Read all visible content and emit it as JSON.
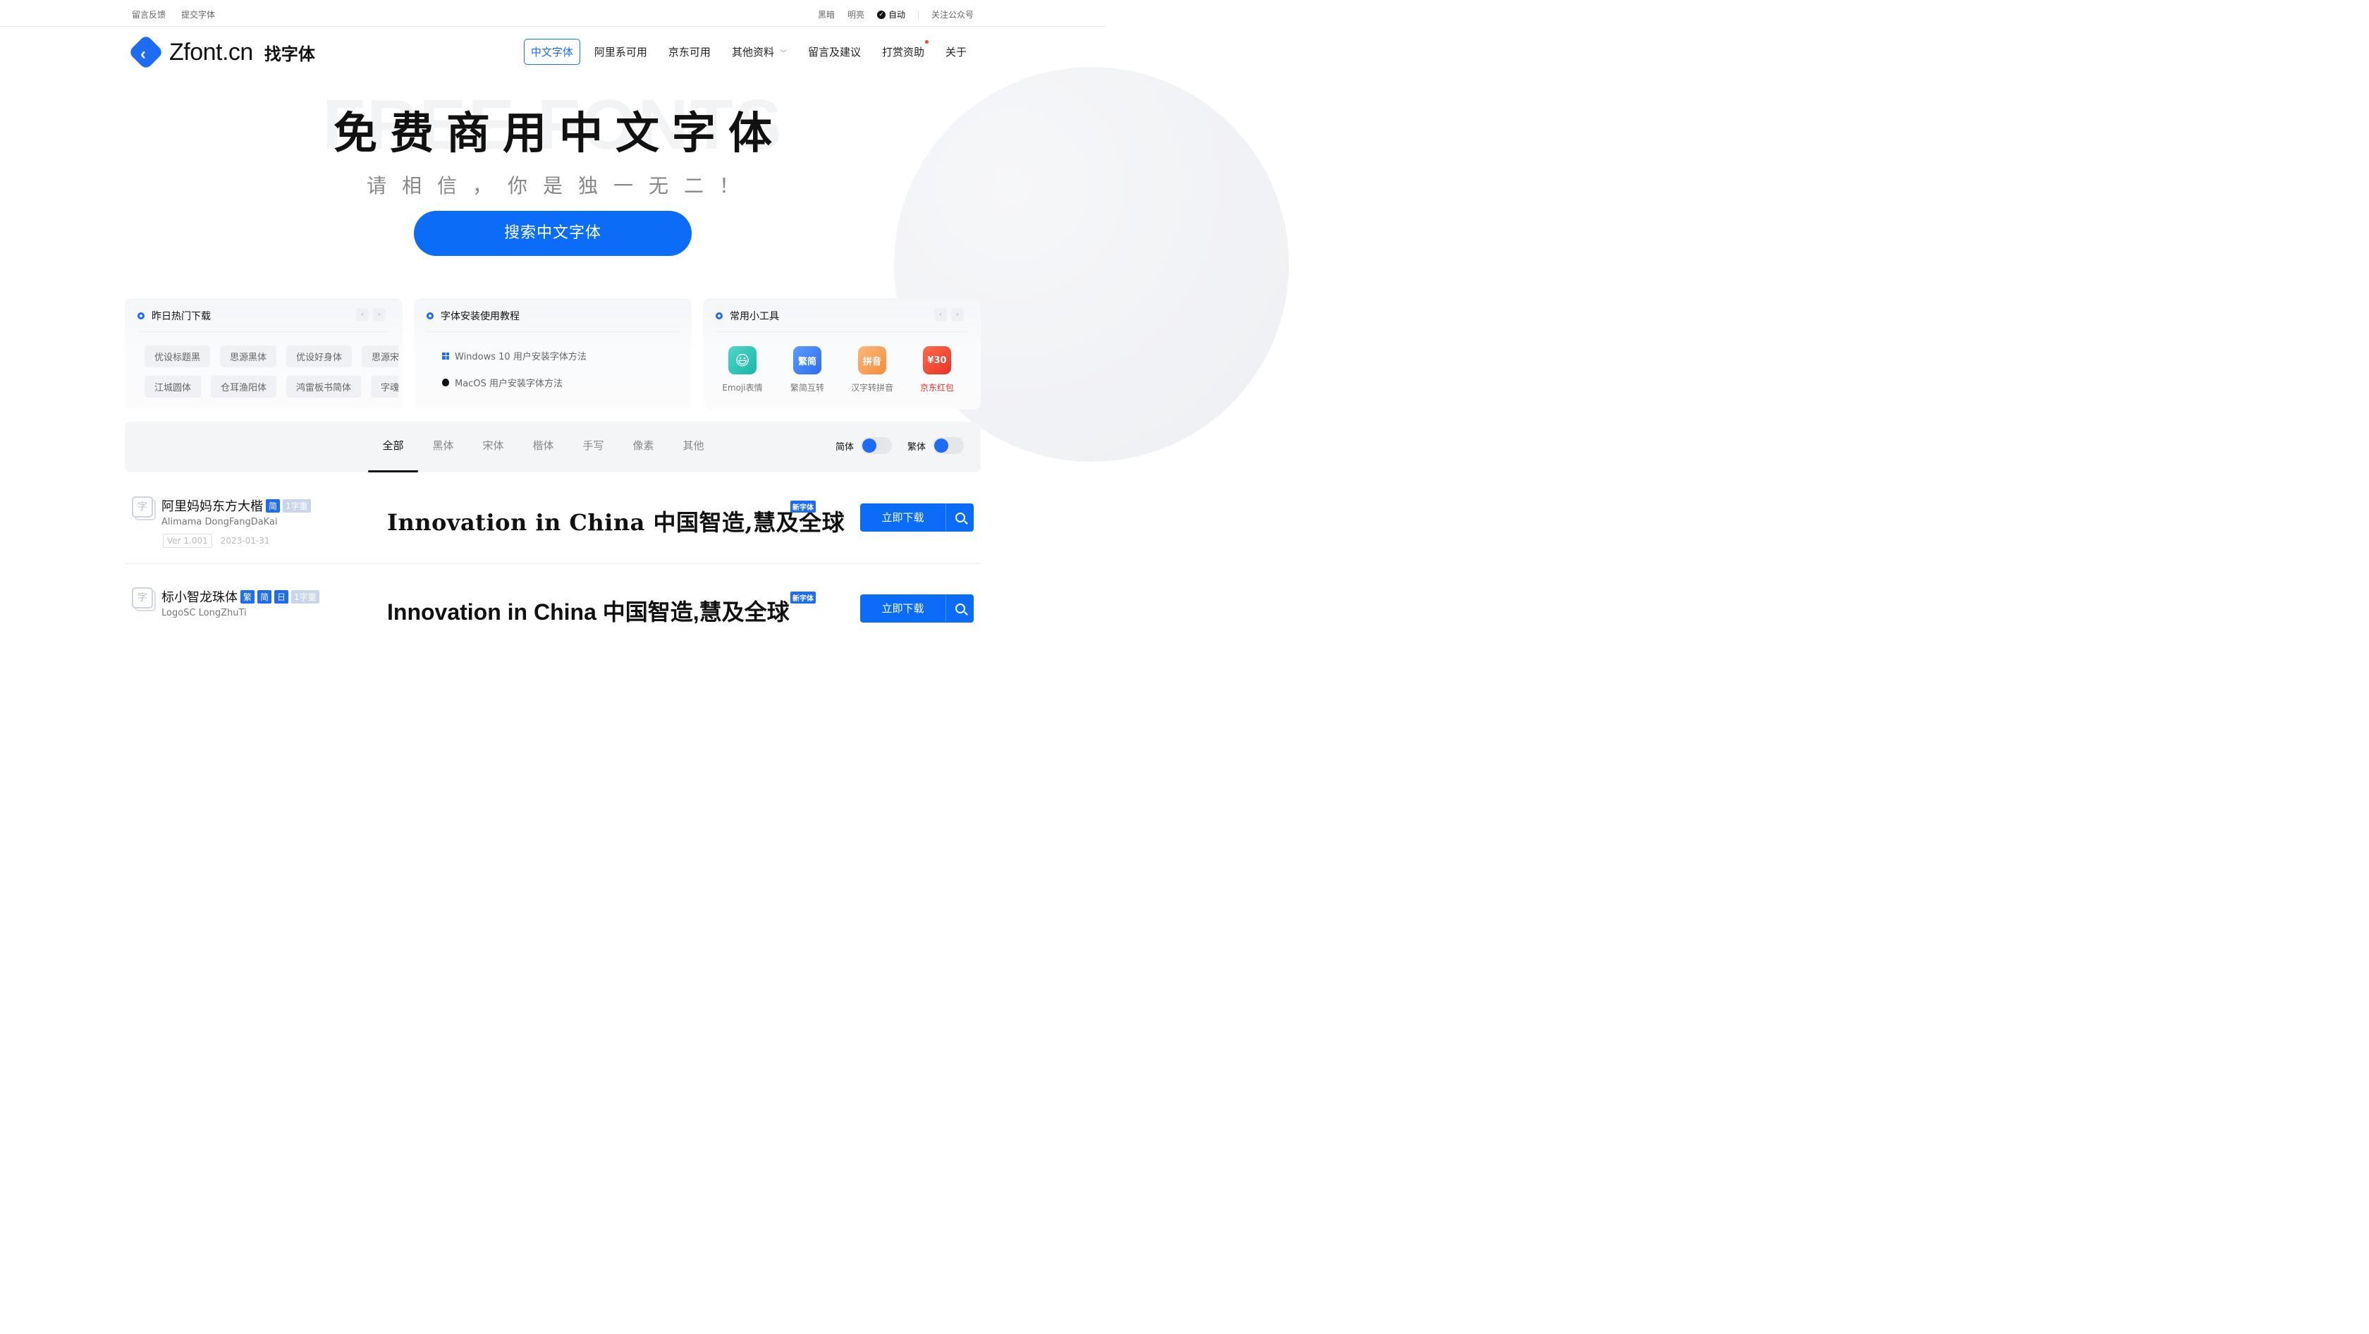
{
  "topbar": {
    "left_links": [
      "留言反馈",
      "提交字体"
    ],
    "theme_dark": "黑暗",
    "theme_light": "明亮",
    "theme_auto": "自动",
    "follow": "关注公众号"
  },
  "header": {
    "logo_text": "Zfont.cn",
    "logo_cn": "找字体",
    "nav": [
      "中文字体",
      "阿里系可用",
      "京东可用",
      "其他资料",
      "留言及建议",
      "打赏资助",
      "关于"
    ],
    "nav_active_index": 0
  },
  "hero": {
    "bg_text": "FREE FONTS",
    "title": "免费商用中文字体",
    "slogan": "请相信，你是独一无二！",
    "search_button": "搜索中文字体"
  },
  "cards": {
    "hot": {
      "title": "昨日热门下载",
      "row1": [
        "优设标题黑",
        "思源黑体",
        "优设好身体",
        "思源宋体"
      ],
      "row2": [
        "江城圆体",
        "仓耳渔阳体",
        "鸿雷板书简体",
        "字魂"
      ]
    },
    "tutorial": {
      "title": "字体安装使用教程",
      "items": [
        "Windows 10 用户安装字体方法",
        "MacOS 用户安装字体方法"
      ]
    },
    "tools": {
      "title": "常用小工具",
      "items": [
        {
          "label": "Emoji表情",
          "icon": "emoji-icon",
          "glyph": "😃"
        },
        {
          "label": "繁简互转",
          "icon": "convert-icon",
          "glyph": "繁简"
        },
        {
          "label": "汉字转拼音",
          "icon": "pinyin-icon",
          "glyph": "拼音"
        },
        {
          "label": "京东红包",
          "icon": "redpacket-icon",
          "glyph": "¥30"
        }
      ]
    }
  },
  "tabs": [
    "全部",
    "黑体",
    "宋体",
    "楷体",
    "手写",
    "像素",
    "其他"
  ],
  "toggles": {
    "simplified": "简体",
    "traditional": "繁体"
  },
  "fonts": [
    {
      "name": "阿里妈妈东方大楷",
      "tags": [
        "简"
      ],
      "weight_tag": "1字重",
      "en_name": "Alimama DongFangDaKai",
      "version": "Ver 1.001",
      "date": "2023-01-31",
      "preview": "Innovation  in China 中国智造,慧及全球",
      "new_tag": "新字体",
      "download": "立即下载"
    },
    {
      "name": "标小智龙珠体",
      "tags": [
        "繁",
        "简",
        "日"
      ],
      "weight_tag": "1字重",
      "en_name": "LogoSC LongZhuTi",
      "preview": "Innovation  in China 中国智造,慧及全球",
      "new_tag": "新字体",
      "download": "立即下载"
    }
  ],
  "colors": {
    "accent": "#0b6cf7",
    "red": "#e8322b"
  }
}
